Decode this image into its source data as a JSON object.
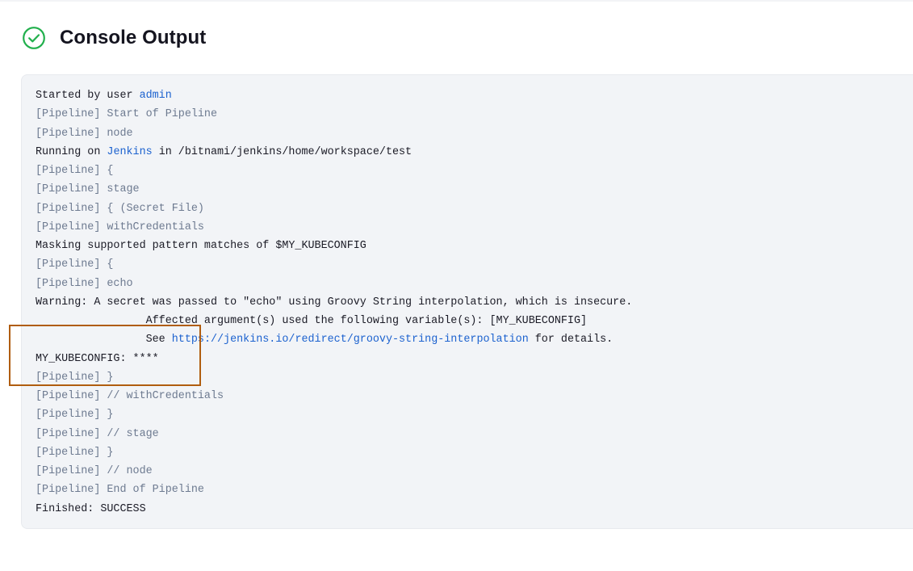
{
  "header": {
    "title": "Console Output",
    "status_icon": "check-circle-icon",
    "status_color": "#22b04d"
  },
  "console": {
    "line_01": {
      "prefix": "Started by user ",
      "link": "admin"
    },
    "line_02": {
      "text": "[Pipeline] Start of Pipeline"
    },
    "line_03": {
      "text": "[Pipeline] node"
    },
    "line_04": {
      "prefix": "Running on ",
      "link": "Jenkins",
      "suffix": " in /bitnami/jenkins/home/workspace/test"
    },
    "line_05": {
      "text": "[Pipeline] {"
    },
    "line_06": {
      "text": "[Pipeline] stage"
    },
    "line_07": {
      "text": "[Pipeline] { (Secret File)"
    },
    "line_08": {
      "text": "[Pipeline] withCredentials"
    },
    "line_09": {
      "text": "Masking supported pattern matches of $MY_KUBECONFIG"
    },
    "line_10": {
      "text": "[Pipeline] {"
    },
    "line_11": {
      "text": "[Pipeline] echo"
    },
    "line_12": {
      "text": "Warning: A secret was passed to \"echo\" using Groovy String interpolation, which is insecure."
    },
    "line_13": {
      "text": "\t\t Affected argument(s) used the following variable(s): [MY_KUBECONFIG]"
    },
    "line_14": {
      "prefix": "\t\t See ",
      "link": "https://jenkins.io/redirect/groovy-string-interpolation",
      "suffix": " for details."
    },
    "line_15": {
      "text": "MY_KUBECONFIG: ****"
    },
    "line_16": {
      "text": "[Pipeline] }"
    },
    "line_17": {
      "text": "[Pipeline] // withCredentials"
    },
    "line_18": {
      "text": "[Pipeline] }"
    },
    "line_19": {
      "text": "[Pipeline] // stage"
    },
    "line_20": {
      "text": "[Pipeline] }"
    },
    "line_21": {
      "text": "[Pipeline] // node"
    },
    "line_22": {
      "text": "[Pipeline] End of Pipeline"
    },
    "line_23": {
      "text": "Finished: SUCCESS"
    }
  },
  "colors": {
    "pipeline_text": "#6d7a90",
    "link": "#1c62cf",
    "highlight_border": "#b05d0f",
    "console_bg": "#f2f4f7"
  }
}
